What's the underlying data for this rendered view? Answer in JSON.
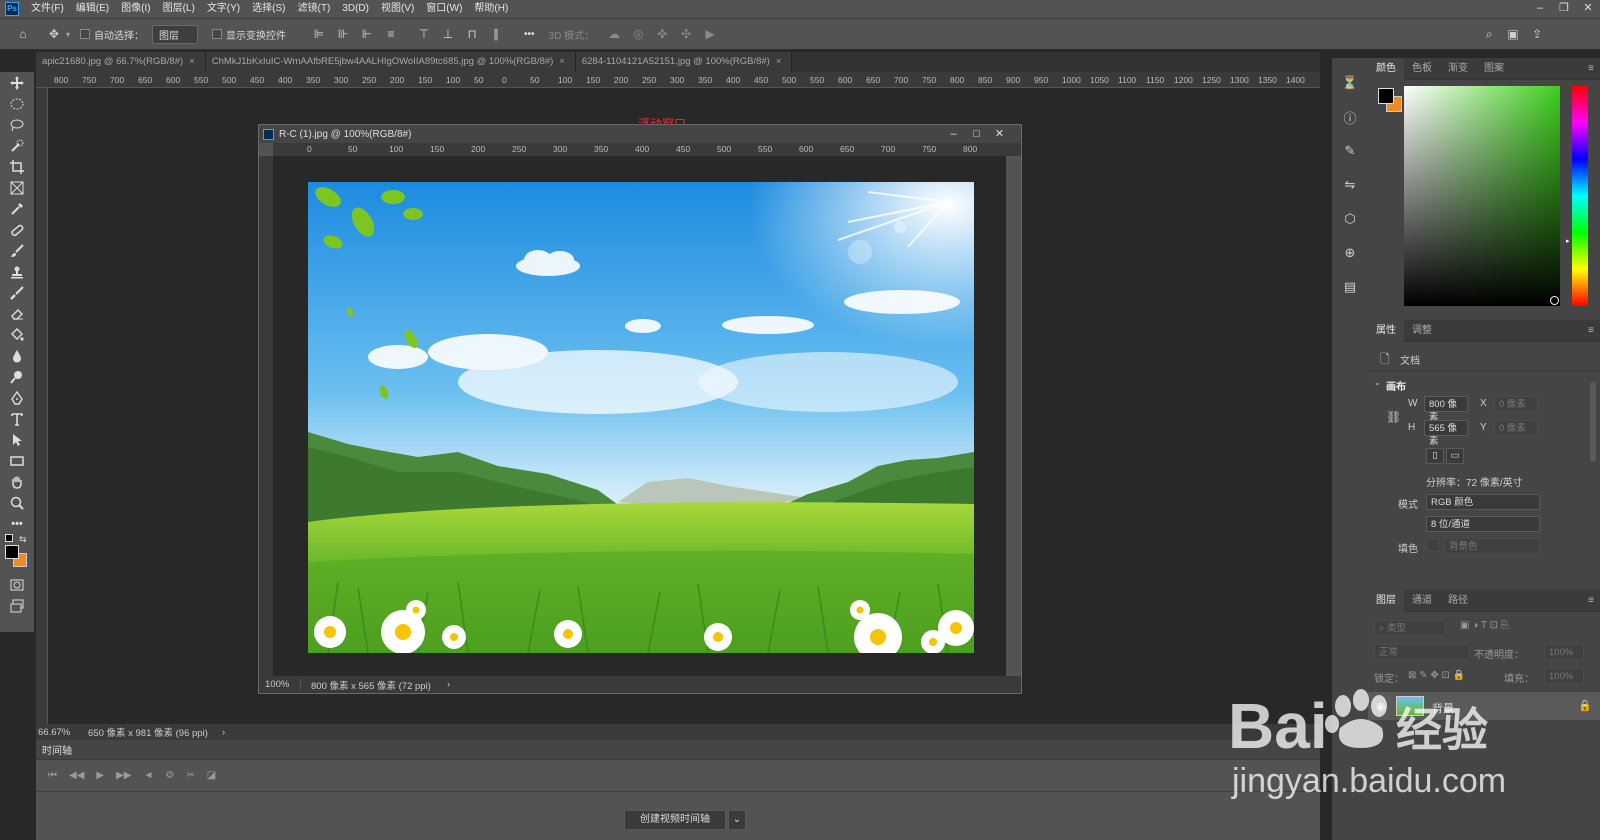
{
  "menu": {
    "app_icon": "Ps",
    "items": [
      "文件(F)",
      "编辑(E)",
      "图像(I)",
      "图层(L)",
      "文字(Y)",
      "选择(S)",
      "滤镜(T)",
      "3D(D)",
      "视图(V)",
      "窗口(W)",
      "帮助(H)"
    ],
    "window_controls": [
      "minimize-icon",
      "restore-icon",
      "close-icon"
    ]
  },
  "options": {
    "auto_select_label": "自动选择：",
    "auto_select_value": "图层",
    "show_transform_label": "显示变换控件",
    "more": "•••",
    "mode_3d_label": "3D 模式："
  },
  "tabs": [
    {
      "label": "apic21680.jpg @ 66.7%(RGB/8#)",
      "close": "×"
    },
    {
      "label": "ChMkJ1bKxIuIC-WmAAfbRE5jbw4AALHIgOWoIIA89tc685.jpg @ 100%(RGB/8#)",
      "close": "×"
    },
    {
      "label": "6284-1104121A52151.jpg @ 100%(RGB/8#)",
      "close": "×"
    }
  ],
  "main_ruler": [
    "800",
    "750",
    "700",
    "650",
    "600",
    "550",
    "500",
    "450",
    "400",
    "350",
    "300",
    "250",
    "200",
    "150",
    "100",
    "50",
    "0",
    "50",
    "100",
    "150",
    "200",
    "250",
    "300",
    "350",
    "400",
    "450",
    "500",
    "550",
    "600",
    "650",
    "700",
    "750",
    "800",
    "850",
    "900",
    "950",
    "1000",
    "1050",
    "1100",
    "1150",
    "1200",
    "1250",
    "1300",
    "1350",
    "1400"
  ],
  "status": {
    "zoom": "66.67%",
    "doc": "650 像素 x 981 像素 (96 ppi)",
    "arrow": "›"
  },
  "timeline": {
    "title": "时间轴",
    "create_button": "创建视频时间轴",
    "dropdown": "⌄"
  },
  "float_label": "浮动窗口",
  "float_window": {
    "title": "R-C (1).jpg @ 100%(RGB/8#)",
    "ruler": [
      "0",
      "50",
      "100",
      "150",
      "200",
      "250",
      "300",
      "350",
      "400",
      "450",
      "500",
      "550",
      "600",
      "650",
      "700",
      "750",
      "800"
    ],
    "zoom": "100%",
    "doc": "800 像素 x 565 像素 (72 ppi)",
    "arrow": "›"
  },
  "color_panel": {
    "tabs": [
      "颜色",
      "色板",
      "渐变",
      "图案"
    ],
    "menu": "≡",
    "foreground": "#000000",
    "background": "#f08a24",
    "hue_color": "#3ecf1c"
  },
  "properties": {
    "tabs": [
      "属性",
      "调整"
    ],
    "doc_label": "文档",
    "canvas_label": "画布",
    "w_label": "W",
    "w_value": "800 像素",
    "h_label": "H",
    "h_value": "565 像素",
    "x_label": "X",
    "x_value": "0 像素",
    "y_label": "Y",
    "y_value": "0 像素",
    "resolution": "分辨率：72 像素/英寸",
    "mode_label": "模式",
    "mode_value": "RGB 颜色",
    "depth_value": "8 位/通道",
    "fill_label": "填色",
    "fill_value": "背景色"
  },
  "layers": {
    "tabs": [
      "图层",
      "通道",
      "路径"
    ],
    "filter_placeholder": "类型",
    "blend": "正常",
    "opacity_label": "不透明度：",
    "opacity_value": "100%",
    "lock_label": "锁定：",
    "fill_label": "填充：",
    "fill_value": "100%",
    "layer_name": "背景"
  },
  "watermark": {
    "brand": "Bai",
    "brand2": "经验",
    "url": "jingyan.baidu.com"
  },
  "colors": {
    "accent": "#31a8ff",
    "red_label": "#ff2b2b"
  }
}
